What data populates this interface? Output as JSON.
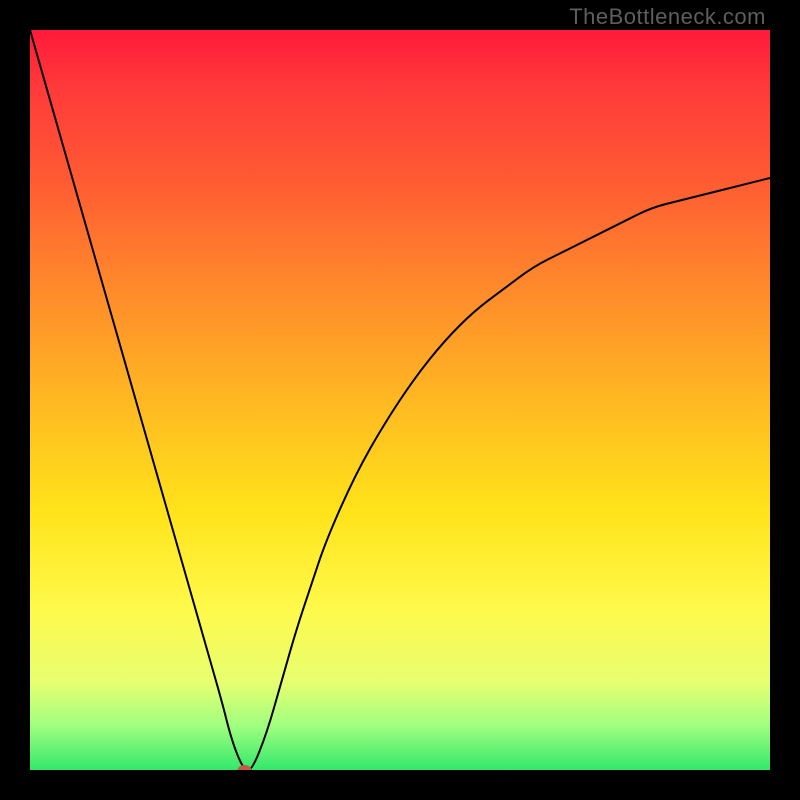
{
  "watermark": "TheBottleneck.com",
  "colors": {
    "frame": "#000000",
    "top": "#ff1a3a",
    "mid": "#ffe31a",
    "bottom": "#33e86b",
    "curve": "#000000",
    "marker": "#c65a4a"
  },
  "chart_data": {
    "type": "line",
    "title": "",
    "xlabel": "",
    "ylabel": "",
    "xlim": [
      0,
      100
    ],
    "ylim": [
      0,
      100
    ],
    "x": [
      0,
      2,
      4,
      6,
      8,
      10,
      12,
      14,
      16,
      18,
      20,
      22,
      24,
      26,
      27,
      28,
      29,
      30,
      32,
      34,
      36,
      38,
      40,
      44,
      48,
      52,
      56,
      60,
      64,
      68,
      72,
      76,
      80,
      84,
      88,
      92,
      96,
      100
    ],
    "values": [
      100,
      93,
      86,
      79,
      72,
      65,
      58,
      51,
      44,
      37,
      30,
      23,
      16,
      9,
      5,
      2,
      0,
      0,
      5,
      12,
      19,
      25,
      31,
      40,
      47,
      53,
      58,
      62,
      65,
      68,
      70,
      72,
      74,
      76,
      77,
      78,
      79,
      80
    ],
    "marker": {
      "x": 29,
      "y": 0
    },
    "grid": false,
    "legend": false
  }
}
